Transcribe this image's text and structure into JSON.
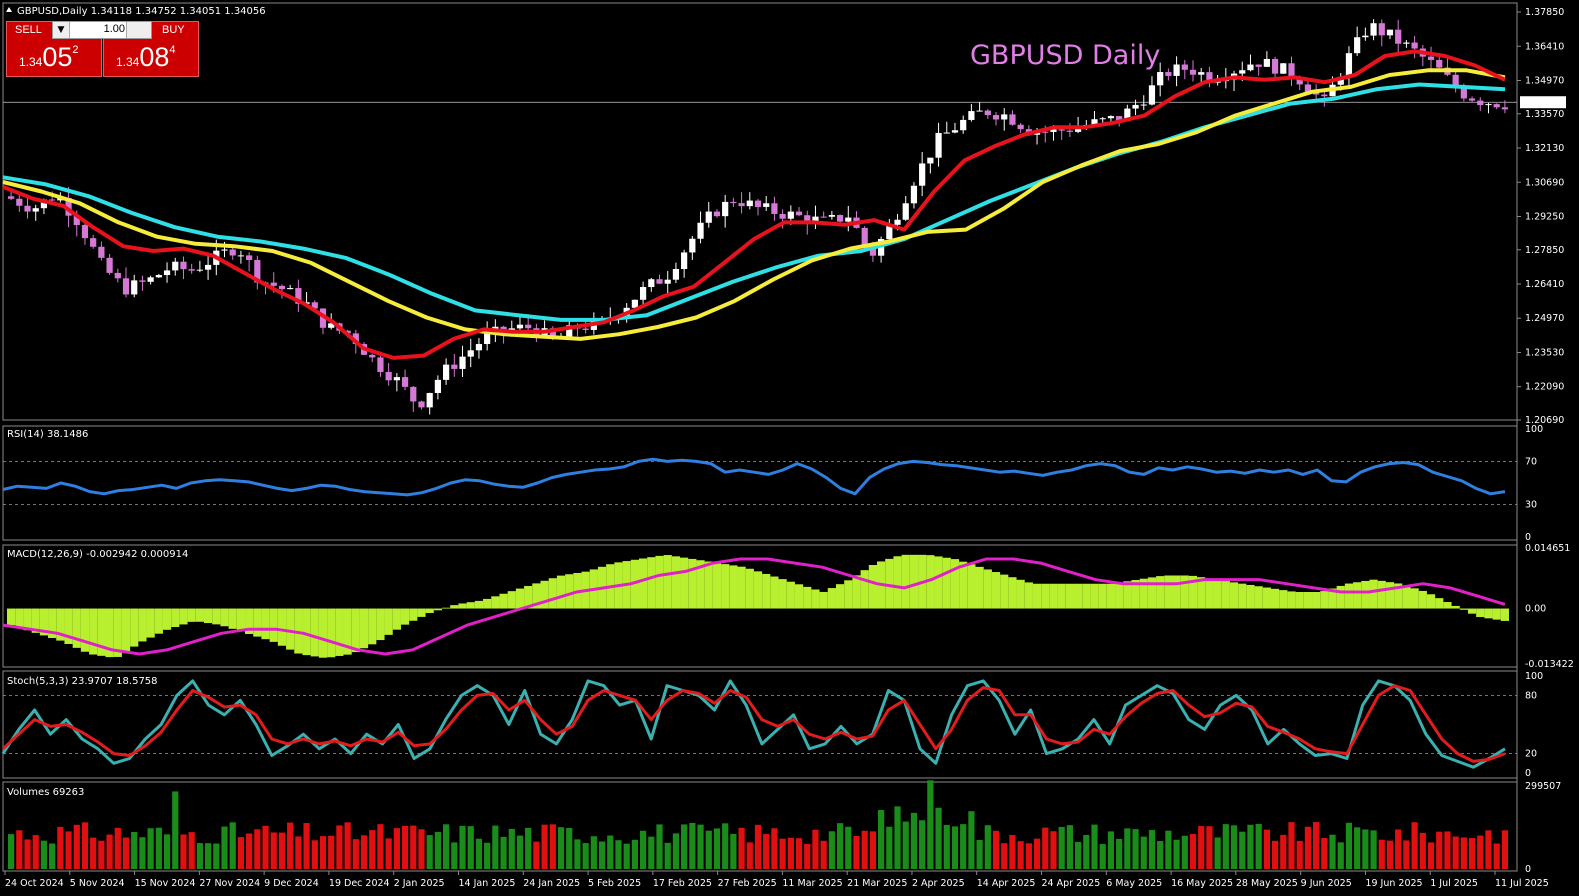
{
  "header": {
    "symbol_label": "GBPUSD,Daily",
    "ohlc": "1.34118 1.34752 1.34051 1.34056"
  },
  "chart_title": "GBPUSD Daily",
  "trade_panel": {
    "sell_label": "SELL",
    "buy_label": "BUY",
    "lot_value": "1.00",
    "sell_price": {
      "prefix": "1.34",
      "big": "05",
      "sup": "2"
    },
    "buy_price": {
      "prefix": "1.34",
      "big": "08",
      "sup": "4"
    }
  },
  "colors": {
    "bull_candle": "#ffffff",
    "bear_candle": "#d679d6",
    "ma_fast": "#e8121c",
    "ma_mid": "#f6ec3c",
    "ma_slow": "#2ee0e6",
    "rsi": "#2f7fe0",
    "macd_hist": "#b8f030",
    "macd_signal": "#e020c8",
    "stoch_main": "#3ab0b0",
    "stoch_signal": "#e01c1c",
    "vol_up": "#1a8c1a",
    "vol_down": "#e01010",
    "price_line": "#c8c8c8"
  },
  "chart_data": [
    {
      "type": "candlestick",
      "title": "GBPUSD Daily",
      "symbol": "GBPUSD",
      "timeframe": "Daily",
      "ylim": [
        1.2069,
        1.3823
      ],
      "y_ticks": [
        "1.37850",
        "1.36410",
        "1.34970",
        "1.33570",
        "1.32130",
        "1.30690",
        "1.29250",
        "1.27850",
        "1.26410",
        "1.24970",
        "1.23530",
        "1.22090",
        "1.20690"
      ],
      "current_price": "1.34056",
      "x_labels": [
        "24 Oct 2024",
        "5 Nov 2024",
        "15 Nov 2024",
        "27 Nov 2024",
        "9 Dec 2024",
        "19 Dec 2024",
        "2 Jan 2025",
        "14 Jan 2025",
        "24 Jan 2025",
        "5 Feb 2025",
        "17 Feb 2025",
        "27 Feb 2025",
        "11 Mar 2025",
        "21 Mar 2025",
        "2 Apr 2025",
        "14 Apr 2025",
        "24 Apr 2025",
        "6 May 2025",
        "16 May 2025",
        "28 May 2025",
        "9 Jun 2025",
        "19 Jun 2025",
        "1 Jul 2025",
        "11 Jul 2025"
      ],
      "close_anchors": [
        1.3,
        1.296,
        1.302,
        1.29,
        1.272,
        1.262,
        1.265,
        1.271,
        1.27,
        1.275,
        1.28,
        1.266,
        1.262,
        1.256,
        1.246,
        1.243,
        1.232,
        1.224,
        1.213,
        1.226,
        1.234,
        1.242,
        1.245,
        1.246,
        1.24,
        1.246,
        1.247,
        1.254,
        1.262,
        1.268,
        1.282,
        1.294,
        1.3,
        1.296,
        1.294,
        1.292,
        1.29,
        1.293,
        1.276,
        1.291,
        1.31,
        1.325,
        1.332,
        1.337,
        1.335,
        1.329,
        1.328,
        1.33,
        1.332,
        1.334,
        1.342,
        1.353,
        1.355,
        1.351,
        1.354,
        1.358,
        1.355,
        1.35,
        1.34,
        1.358,
        1.373,
        1.368,
        1.362,
        1.355,
        1.345,
        1.341,
        1.34
      ],
      "ma_fast": [
        1.305,
        1.3,
        1.297,
        1.288,
        1.28,
        1.278,
        1.279,
        1.276,
        1.269,
        1.262,
        1.256,
        1.248,
        1.237,
        1.233,
        1.234,
        1.241,
        1.245,
        1.244,
        1.244,
        1.246,
        1.248,
        1.253,
        1.259,
        1.263,
        1.273,
        1.283,
        1.29,
        1.29,
        1.289,
        1.291,
        1.287,
        1.303,
        1.316,
        1.322,
        1.327,
        1.33,
        1.33,
        1.332,
        1.335,
        1.343,
        1.349,
        1.351,
        1.35,
        1.351,
        1.349,
        1.352,
        1.36,
        1.362,
        1.36,
        1.356,
        1.35
      ],
      "ma_mid": [
        1.307,
        1.303,
        1.298,
        1.29,
        1.284,
        1.281,
        1.28,
        1.278,
        1.273,
        1.265,
        1.257,
        1.25,
        1.245,
        1.243,
        1.242,
        1.241,
        1.243,
        1.246,
        1.25,
        1.257,
        1.266,
        1.274,
        1.279,
        1.282,
        1.286,
        1.287,
        1.296,
        1.307,
        1.314,
        1.32,
        1.323,
        1.328,
        1.335,
        1.34,
        1.345,
        1.347,
        1.352,
        1.354,
        1.354,
        1.351
      ],
      "ma_slow": [
        1.309,
        1.306,
        1.301,
        1.294,
        1.288,
        1.284,
        1.282,
        1.279,
        1.275,
        1.268,
        1.26,
        1.253,
        1.251,
        1.249,
        1.249,
        1.251,
        1.258,
        1.265,
        1.271,
        1.276,
        1.278,
        1.283,
        1.291,
        1.299,
        1.306,
        1.313,
        1.319,
        1.324,
        1.33,
        1.335,
        1.34,
        1.342,
        1.346,
        1.348,
        1.347,
        1.346
      ]
    },
    {
      "type": "line",
      "title": "RSI(14)",
      "value_label": "RSI(14) 38.1486",
      "ylim": [
        0,
        100
      ],
      "y_ticks": [
        "100",
        "70",
        "30",
        "0"
      ],
      "values": [
        44,
        47,
        46,
        45,
        50,
        47,
        42,
        40,
        43,
        44,
        46,
        48,
        45,
        50,
        52,
        53,
        52,
        51,
        48,
        45,
        43,
        45,
        48,
        47,
        44,
        42,
        41,
        40,
        39,
        41,
        45,
        50,
        53,
        52,
        49,
        47,
        46,
        50,
        55,
        58,
        60,
        62,
        63,
        65,
        70,
        72,
        70,
        71,
        70,
        68,
        60,
        62,
        60,
        58,
        62,
        68,
        63,
        55,
        45,
        40,
        55,
        63,
        68,
        70,
        69,
        67,
        66,
        64,
        62,
        60,
        61,
        59,
        57,
        60,
        62,
        66,
        68,
        66,
        60,
        58,
        64,
        62,
        65,
        63,
        60,
        61,
        59,
        62,
        60,
        62,
        58,
        62,
        52,
        51,
        60,
        65,
        68,
        69,
        67,
        60,
        56,
        52,
        45,
        40,
        42
      ]
    },
    {
      "type": "bar",
      "title": "MACD(12,26,9)",
      "value_label": "MACD(12,26,9) -0.002942 0.000914",
      "ylim": [
        -0.013422,
        0.014651
      ],
      "y_ticks": [
        "0.014651",
        "0.00",
        "-0.013422"
      ],
      "histogram": [
        -0.004,
        -0.006,
        -0.008,
        -0.011,
        -0.012,
        -0.008,
        -0.005,
        -0.003,
        -0.004,
        -0.006,
        -0.008,
        -0.011,
        -0.012,
        -0.011,
        -0.008,
        -0.004,
        -0.001,
        0.001,
        0.002,
        0.004,
        0.006,
        0.008,
        0.009,
        0.011,
        0.012,
        0.013,
        0.012,
        0.011,
        0.01,
        0.008,
        0.006,
        0.004,
        0.007,
        0.011,
        0.013,
        0.013,
        0.012,
        0.01,
        0.008,
        0.006,
        0.006,
        0.006,
        0.006,
        0.007,
        0.008,
        0.008,
        0.007,
        0.006,
        0.005,
        0.004,
        0.004,
        0.006,
        0.007,
        0.006,
        0.004,
        0.001,
        -0.002,
        -0.003
      ],
      "signal": [
        -0.004,
        -0.005,
        -0.006,
        -0.008,
        -0.01,
        -0.011,
        -0.01,
        -0.008,
        -0.006,
        -0.005,
        -0.005,
        -0.006,
        -0.008,
        -0.01,
        -0.011,
        -0.01,
        -0.007,
        -0.004,
        -0.002,
        0.0,
        0.002,
        0.004,
        0.005,
        0.006,
        0.008,
        0.009,
        0.011,
        0.012,
        0.012,
        0.011,
        0.01,
        0.008,
        0.006,
        0.005,
        0.007,
        0.01,
        0.012,
        0.012,
        0.011,
        0.009,
        0.007,
        0.006,
        0.006,
        0.006,
        0.007,
        0.007,
        0.007,
        0.006,
        0.005,
        0.004,
        0.004,
        0.005,
        0.006,
        0.005,
        0.003,
        0.001
      ]
    },
    {
      "type": "line",
      "title": "Stoch(5,3,3)",
      "value_label": "Stoch(5,3,3) 23.9707 18.5758",
      "ylim": [
        0,
        100
      ],
      "y_ticks": [
        "100",
        "80",
        "20",
        "0"
      ],
      "main": [
        20,
        45,
        65,
        40,
        55,
        35,
        25,
        10,
        15,
        35,
        50,
        80,
        95,
        70,
        60,
        75,
        50,
        18,
        28,
        40,
        25,
        35,
        20,
        40,
        30,
        50,
        15,
        25,
        55,
        80,
        90,
        80,
        50,
        85,
        40,
        30,
        55,
        95,
        90,
        70,
        75,
        35,
        90,
        85,
        80,
        65,
        95,
        70,
        30,
        45,
        60,
        25,
        30,
        48,
        30,
        40,
        85,
        75,
        25,
        10,
        60,
        90,
        95,
        75,
        40,
        65,
        20,
        25,
        35,
        55,
        30,
        70,
        80,
        90,
        82,
        55,
        45,
        70,
        80,
        65,
        30,
        45,
        30,
        18,
        20,
        15,
        70,
        95,
        90,
        75,
        40,
        18,
        12,
        6,
        15,
        25
      ],
      "signal": [
        25,
        40,
        55,
        48,
        50,
        42,
        32,
        20,
        18,
        28,
        42,
        65,
        85,
        78,
        68,
        70,
        60,
        35,
        30,
        35,
        30,
        33,
        28,
        35,
        32,
        42,
        28,
        30,
        45,
        65,
        80,
        82,
        65,
        75,
        55,
        40,
        48,
        75,
        85,
        80,
        75,
        55,
        75,
        85,
        82,
        72,
        85,
        78,
        55,
        48,
        55,
        40,
        35,
        42,
        35,
        38,
        65,
        75,
        50,
        25,
        45,
        75,
        88,
        85,
        60,
        60,
        35,
        30,
        32,
        45,
        40,
        58,
        72,
        82,
        85,
        70,
        58,
        62,
        72,
        68,
        48,
        42,
        35,
        25,
        22,
        20,
        50,
        80,
        90,
        85,
        60,
        35,
        20,
        12,
        14,
        20
      ]
    },
    {
      "type": "bar",
      "title": "Volumes",
      "value_label": "Volumes 69263",
      "ylim": [
        0,
        299507
      ],
      "y_ticks": [
        "299507",
        "0"
      ]
    }
  ]
}
